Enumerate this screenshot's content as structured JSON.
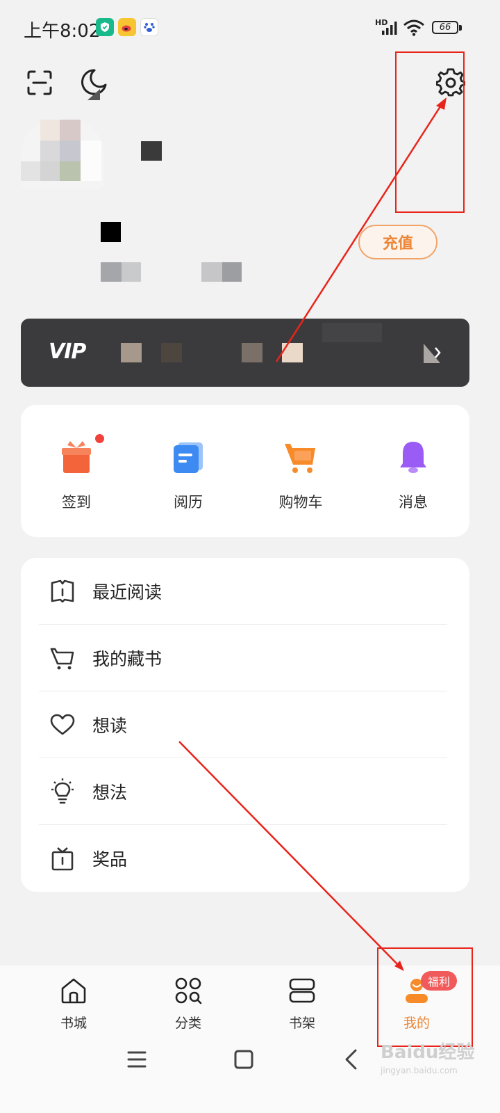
{
  "status_bar": {
    "time": "上午8:02",
    "network_label": "HD",
    "battery": "66"
  },
  "header": {
    "scan_icon": "scan-icon",
    "night_mode_icon": "moon-icon",
    "settings_icon": "gear-icon"
  },
  "profile": {
    "recharge_label": "充值"
  },
  "vip": {
    "logo": "VIP"
  },
  "shortcuts": [
    {
      "label": "签到",
      "icon": "gift-icon",
      "color": "#f4643a",
      "has_dot": true
    },
    {
      "label": "阅历",
      "icon": "document-icon",
      "color": "#3d8bf2",
      "has_dot": false
    },
    {
      "label": "购物车",
      "icon": "cart-icon",
      "color": "#f78b2a",
      "has_dot": false
    },
    {
      "label": "消息",
      "icon": "bell-icon",
      "color": "#9b5cf5",
      "has_dot": false
    }
  ],
  "menu": [
    {
      "label": "最近阅读",
      "icon": "book-icon"
    },
    {
      "label": "我的藏书",
      "icon": "cart-outline-icon"
    },
    {
      "label": "想读",
      "icon": "heart-icon"
    },
    {
      "label": "想法",
      "icon": "lightbulb-icon"
    },
    {
      "label": "奖品",
      "icon": "prize-box-icon"
    }
  ],
  "bottom_nav": [
    {
      "label": "书城",
      "icon": "home-icon",
      "active": false
    },
    {
      "label": "分类",
      "icon": "category-icon",
      "active": false
    },
    {
      "label": "书架",
      "icon": "bookshelf-icon",
      "active": false
    },
    {
      "label": "我的",
      "icon": "profile-icon",
      "active": true
    }
  ],
  "bottom_nav_badge": "福利",
  "colors": {
    "accent": "#ec8636",
    "vip_bar": "#3b3b3d",
    "annotation": "#e8241a"
  },
  "watermark": {
    "text": "Baidu经验",
    "sub": "jingyan.baidu.com"
  }
}
